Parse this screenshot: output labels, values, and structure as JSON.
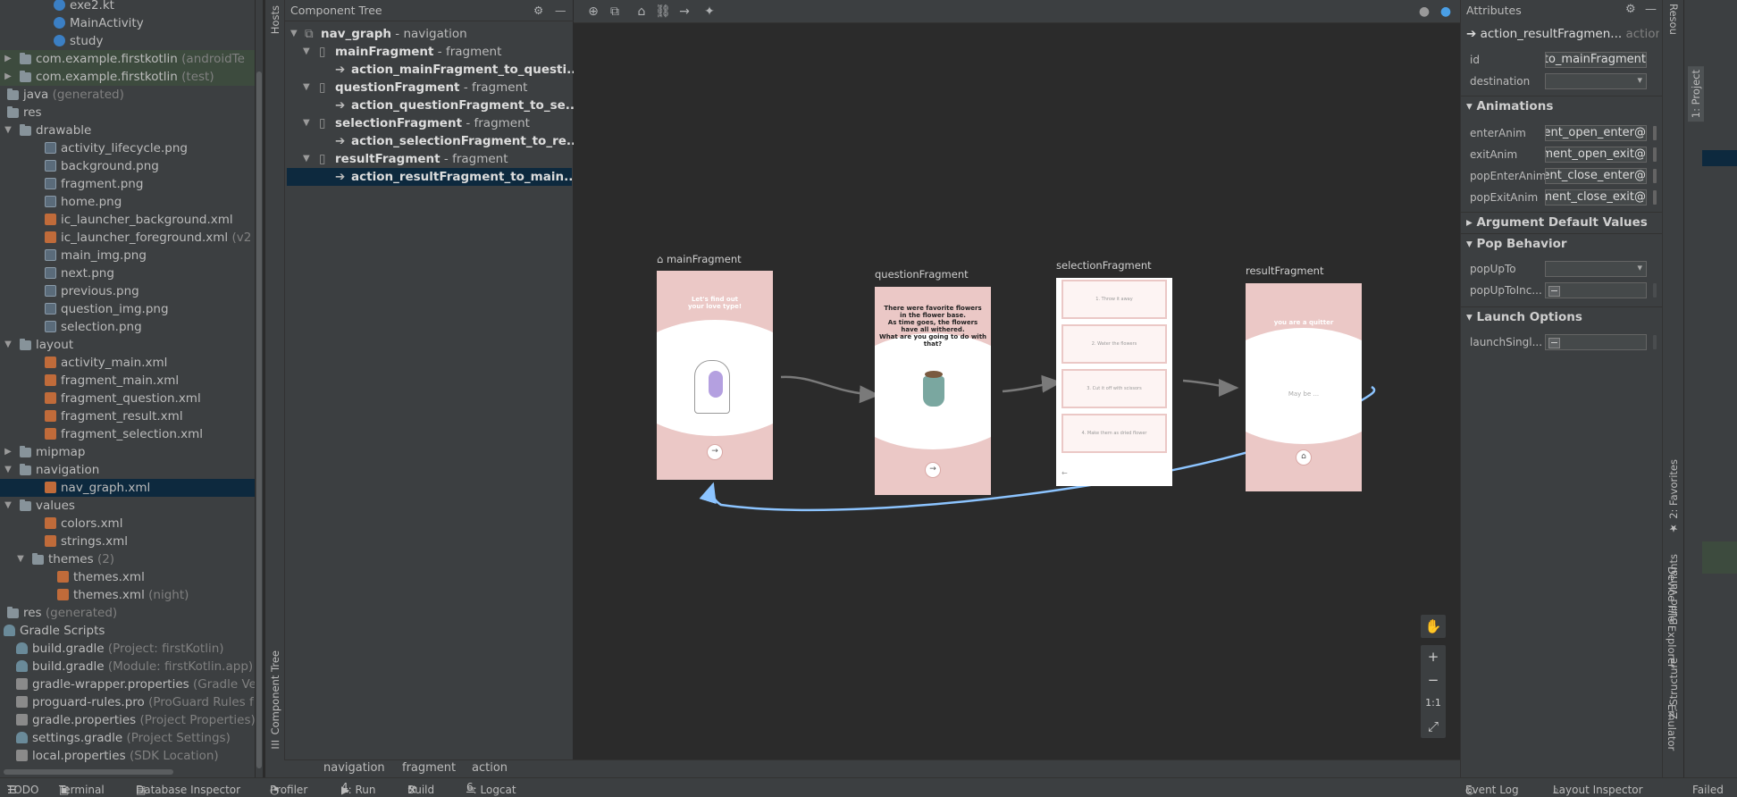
{
  "project_tree": [
    {
      "label": "exe2.kt",
      "icon": "kotlin-file-icon"
    },
    {
      "label": "MainActivity",
      "icon": "kotlin-file-icon"
    },
    {
      "label": "study",
      "icon": "kotlin-file-icon"
    },
    {
      "label": "com.example.firstkotlin",
      "hint": "(androidTe",
      "icon": "package-folder-icon",
      "expanded": false
    },
    {
      "label": "com.example.firstkotlin",
      "hint": "(test)",
      "icon": "package-folder-icon",
      "expanded": false
    },
    {
      "label": "java",
      "hint": "(generated)",
      "icon": "folder-icon",
      "expanded": false
    },
    {
      "label": "res",
      "icon": "folder-icon",
      "expanded": true
    },
    {
      "label": "drawable",
      "icon": "folder-icon",
      "expanded": true
    },
    {
      "label": "activity_lifecycle.png",
      "icon": "image-file-icon"
    },
    {
      "label": "background.png",
      "icon": "image-file-icon"
    },
    {
      "label": "fragment.png",
      "icon": "image-file-icon"
    },
    {
      "label": "home.png",
      "icon": "image-file-icon"
    },
    {
      "label": "ic_launcher_background.xml",
      "icon": "xml-file-icon"
    },
    {
      "label": "ic_launcher_foreground.xml",
      "hint": "(v2",
      "icon": "xml-file-icon"
    },
    {
      "label": "main_img.png",
      "icon": "image-file-icon"
    },
    {
      "label": "next.png",
      "icon": "image-file-icon"
    },
    {
      "label": "previous.png",
      "icon": "image-file-icon"
    },
    {
      "label": "question_img.png",
      "icon": "image-file-icon"
    },
    {
      "label": "selection.png",
      "icon": "image-file-icon"
    },
    {
      "label": "layout",
      "icon": "folder-icon",
      "expanded": true
    },
    {
      "label": "activity_main.xml",
      "icon": "xml-file-icon"
    },
    {
      "label": "fragment_main.xml",
      "icon": "xml-file-icon"
    },
    {
      "label": "fragment_question.xml",
      "icon": "xml-file-icon"
    },
    {
      "label": "fragment_result.xml",
      "icon": "xml-file-icon"
    },
    {
      "label": "fragment_selection.xml",
      "icon": "xml-file-icon"
    },
    {
      "label": "mipmap",
      "icon": "folder-icon",
      "expanded": false
    },
    {
      "label": "navigation",
      "icon": "folder-icon",
      "expanded": true
    },
    {
      "label": "nav_graph.xml",
      "icon": "xml-file-icon",
      "selected": true
    },
    {
      "label": "values",
      "icon": "folder-icon",
      "expanded": true
    },
    {
      "label": "colors.xml",
      "icon": "xml-file-icon"
    },
    {
      "label": "strings.xml",
      "icon": "xml-file-icon"
    },
    {
      "label": "themes",
      "hint": "(2)",
      "icon": "folder-icon",
      "expanded": true
    },
    {
      "label": "themes.xml",
      "icon": "xml-file-icon"
    },
    {
      "label": "themes.xml",
      "hint": "(night)",
      "icon": "xml-file-icon"
    },
    {
      "label": "res",
      "hint": "(generated)",
      "icon": "folder-icon"
    },
    {
      "label": "Gradle Scripts",
      "icon": "gradle-icon",
      "expanded": true
    },
    {
      "label": "build.gradle",
      "hint": "(Project: firstKotlin)",
      "icon": "gradle-icon"
    },
    {
      "label": "build.gradle",
      "hint": "(Module: firstKotlin.app)",
      "icon": "gradle-icon"
    },
    {
      "label": "gradle-wrapper.properties",
      "hint": "(Gradle Ve",
      "icon": "properties-file-icon"
    },
    {
      "label": "proguard-rules.pro",
      "hint": "(ProGuard Rules f",
      "icon": "properties-file-icon"
    },
    {
      "label": "gradle.properties",
      "hint": "(Project Properties)",
      "icon": "properties-file-icon"
    },
    {
      "label": "settings.gradle",
      "hint": "(Project Settings)",
      "icon": "gradle-icon"
    },
    {
      "label": "local.properties",
      "hint": "(SDK Location)",
      "icon": "properties-file-icon"
    }
  ],
  "side_tabs": {
    "hosts": "Hosts",
    "component_tree": "Component Tree",
    "resource": "Resou",
    "project": "1: Project",
    "favorites": "2: Favorites",
    "build_variants": "Build Variants",
    "structure": "Z: Structure",
    "device_file_explorer": "Device File Explorer",
    "emulator": "Emulator"
  },
  "component_tree": {
    "title": "Component Tree",
    "root": {
      "name": "nav_graph",
      "type": "- navigation"
    },
    "items": [
      {
        "name": "mainFragment",
        "type": "- fragment",
        "action": "action_mainFragment_to_questi..."
      },
      {
        "name": "questionFragment",
        "type": "- fragment",
        "action": "action_questionFragment_to_se..."
      },
      {
        "name": "selectionFragment",
        "type": "- fragment",
        "action": "action_selectionFragment_to_re..."
      },
      {
        "name": "resultFragment",
        "type": "- fragment",
        "action": "action_resultFragment_to_main..."
      }
    ]
  },
  "graph": {
    "fragments": [
      {
        "label": "mainFragment",
        "text": "Let's find out\nyour love type!",
        "button": "→",
        "start": true
      },
      {
        "label": "questionFragment",
        "text": "There were favorite flowers\nin the flower base.\nAs time goes, the flowers\nhave all withered.\nWhat are you going to do with that?",
        "button": "→"
      },
      {
        "label": "selectionFragment",
        "options": [
          "1. Throw it away",
          "2. Water the flowers",
          "3. Cut it off with scissors",
          "4. Make them as dried flower"
        ],
        "button": "←"
      },
      {
        "label": "resultFragment",
        "text": "you are a quitter",
        "body": "May be ...",
        "button": "⌂"
      }
    ]
  },
  "zoom": {
    "pan": "✋",
    "zoom_in": "+",
    "zoom_out": "−",
    "actual": "1:1",
    "fit": "⤢"
  },
  "breadcrumb": [
    "navigation",
    "fragment",
    "action"
  ],
  "attributes": {
    "title": "Attributes",
    "selected_name": "action_resultFragmen...",
    "selected_type": "action",
    "id_label": "id",
    "id_value": "resultFragment_to_mainFragment",
    "destination_label": "destination",
    "animations_header": "Animations",
    "anims": [
      {
        "label": "enterAnim",
        "value": "@animator/nav_default_enter_anim_fragment_open_enter"
      },
      {
        "label": "exitAnim",
        "value": "@animator/nav_default_exit_anim_fragment_open_exit"
      },
      {
        "label": "popEnterAnim",
        "value": "@animator/nav_default_pop_enter_anim_fragment_close_enter"
      },
      {
        "label": "popExitAnim",
        "value": "@animator/nav_default_pop_exit_anim_fragment_close_exit"
      }
    ],
    "argument_header": "Argument Default Values",
    "pop_header": "Pop Behavior",
    "popUpTo_label": "popUpTo",
    "popUpToInc_label": "popUpToInc...",
    "launch_header": "Launch Options",
    "launchSingle_label": "launchSingl..."
  },
  "status_bar": {
    "todo": "TODO",
    "terminal": "Terminal",
    "db": "Database Inspector",
    "profiler": "Profiler",
    "run_num": "4",
    "run": ": Run",
    "build": "Build",
    "logcat_num": "6",
    "logcat": ": Logcat",
    "event_log": "Event Log",
    "layout_inspector": "Layout Inspector",
    "failed": "Failed"
  },
  "colors": {
    "accent": "#0d293e",
    "fragment_bg": "#ebc8c6",
    "arrow": "#7a7a7a",
    "selected_arrow": "#8cc4ff"
  }
}
